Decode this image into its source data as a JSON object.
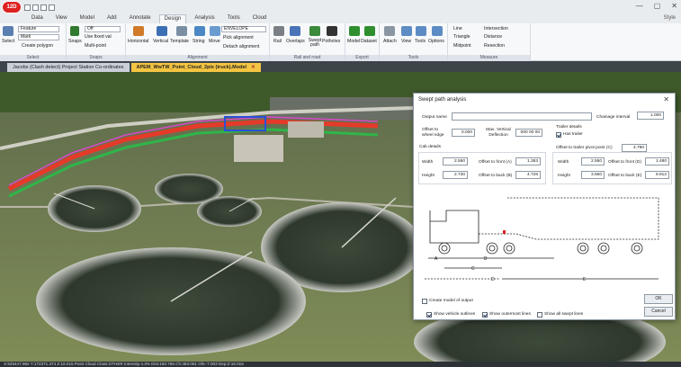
{
  "app": {
    "logo_text": "12D",
    "window_controls": [
      "—",
      "▢",
      "✕"
    ],
    "style_link": "Style"
  },
  "ribbon_tabs": [
    "Data",
    "View",
    "Model",
    "Add",
    "Annotate",
    "Design",
    "Analysis",
    "Tools",
    "Cloud"
  ],
  "active_ribbon_tab": "Design",
  "ribbon": {
    "select": "Select",
    "feature_combo": "Feature",
    "mark_combo": "Mark",
    "create_polygon": "Create polygon",
    "snaps": "Snaps",
    "xy_combo": "Off",
    "use_fixed_val": "Use fixed val",
    "multi_point": "Multi-point",
    "horizontal": "Horizontal",
    "vertical": "Vertical",
    "template": "Template",
    "string": "String",
    "move": "Move",
    "envelope_combo": "ENVELOPE",
    "pick_alignment": "Pick alignment",
    "detach_alignment": "Detach alignment",
    "rail": "Rail",
    "overlaps": "Overlaps",
    "swept_path": "Swept path",
    "potholes": "Potholes",
    "model": "Model",
    "dataset": "Dataset",
    "attach": "Attach",
    "view": "View",
    "tools": "Tools",
    "options": "Options",
    "line": "Line",
    "intersection": "Intersection",
    "triangle": "Triangle",
    "distance": "Distance",
    "midpoint": "Midpoint",
    "resection": "Resection",
    "groups": [
      "Select",
      "Snaps",
      "Alignment",
      "Rail and road",
      "Export",
      "Tools",
      "Measure"
    ]
  },
  "document_tabs": [
    {
      "label": "Jacobs (Clash detect) Project Station Co-ordinates",
      "active": false
    },
    {
      "label": "APEM_WwTW_Point_Cloud_2pix (truck).Model",
      "active": true
    }
  ],
  "statusbar": "X:525447.962 Y:172371.374 Z:16.015    Point Cloud Class:OTHER Intensity:4.3% Dist:183.756 Ch:483.061 Ofs:-7.003 Dep:Z:16.015",
  "dialog": {
    "title": "Swept path analysis",
    "output_name_label": "Output name",
    "output_name_value": "",
    "chainage_interval_label": "Chainage interval",
    "chainage_interval_value": "1.000",
    "offset_wheel_label": "Offset to wheel edge",
    "offset_wheel_value": "0.000",
    "max_vert_label": "Max. Vertical Deflection",
    "max_vert_value": "000 00 00",
    "trailer_details_label": "Trailer details",
    "has_trailer_label": "Has trailer",
    "has_trailer_checked": true,
    "cab_details_label": "Cab details",
    "offset_pivot_label": "Offset to trailer pivot point (C)",
    "offset_pivot_value": "4.790",
    "cab_width_label": "Width",
    "cab_width_value": "2.550",
    "cab_front_label": "Offset to front (A)",
    "cab_front_value": "1.363",
    "cab_height_label": "Height",
    "cab_height_value": "2.730",
    "cab_back_label": "Offset to back (B)",
    "cab_back_value": "4.728",
    "tr_width_label": "Width",
    "tr_width_value": "2.550",
    "tr_front_label": "Offset to front (D)",
    "tr_front_value": "1.480",
    "tr_height_label": "Height",
    "tr_height_value": "3.560",
    "tr_back_label": "Offset to back (E)",
    "tr_back_value": "9.912",
    "diagram_labels": [
      "A",
      "B",
      "C",
      "D",
      "E"
    ],
    "create_model_label": "Create model of output",
    "create_model_checked": false,
    "show_vehicle_label": "Show vehicle outlines",
    "show_vehicle_checked": true,
    "show_outermost_label": "Show outermost lines",
    "show_outermost_checked": true,
    "show_all_label": "Show all swept lines",
    "show_all_checked": false,
    "ok_label": "OK",
    "cancel_label": "Cancel"
  }
}
